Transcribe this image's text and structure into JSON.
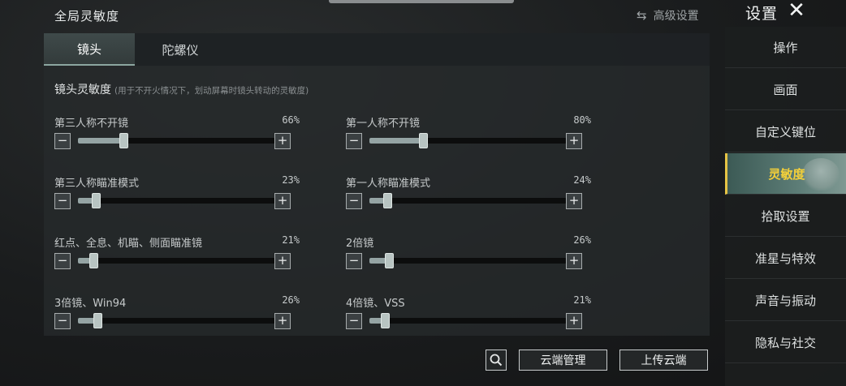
{
  "header": {
    "page_title": "全局灵敏度",
    "advanced_settings": "高级设置",
    "settings_title": "设置",
    "swap_icon": "⇆",
    "close_icon": "✕"
  },
  "tabs": [
    {
      "label": "镜头",
      "active": true
    },
    {
      "label": "陀螺仪",
      "active": false
    }
  ],
  "section": {
    "title": "镜头灵敏度",
    "note": "(用于不开火情况下，划动屏幕时镜头转动的灵敏度)"
  },
  "sliders": [
    {
      "label": "第三人称不开镜",
      "value": "66%",
      "level": 0.23
    },
    {
      "label": "第一人称不开镜",
      "value": "80%",
      "level": 0.27
    },
    {
      "label": "第三人称瞄准模式",
      "value": "23%",
      "level": 0.09
    },
    {
      "label": "第一人称瞄准模式",
      "value": "24%",
      "level": 0.09
    },
    {
      "label": "红点、全息、机瞄、侧面瞄准镜",
      "value": "21%",
      "level": 0.08
    },
    {
      "label": "2倍镜",
      "value": "26%",
      "level": 0.1
    },
    {
      "label": "3倍镜、Win94",
      "value": "26%",
      "level": 0.1
    },
    {
      "label": "4倍镜、VSS",
      "value": "21%",
      "level": 0.08
    }
  ],
  "stepper": {
    "minus": "−",
    "plus": "+"
  },
  "bottom_buttons": {
    "cloud_manage": "云端管理",
    "upload_cloud": "上传云端"
  },
  "sidebar": {
    "items": [
      {
        "label": "操作",
        "active": false
      },
      {
        "label": "画面",
        "active": false
      },
      {
        "label": "自定义键位",
        "active": false
      },
      {
        "label": "灵敏度",
        "active": true
      },
      {
        "label": "拾取设置",
        "active": false
      },
      {
        "label": "准星与特效",
        "active": false
      },
      {
        "label": "声音与振动",
        "active": false
      },
      {
        "label": "隐私与社交",
        "active": false
      }
    ]
  },
  "colors": {
    "active_text": "#f4d03a",
    "accent": "#5d7d77"
  }
}
